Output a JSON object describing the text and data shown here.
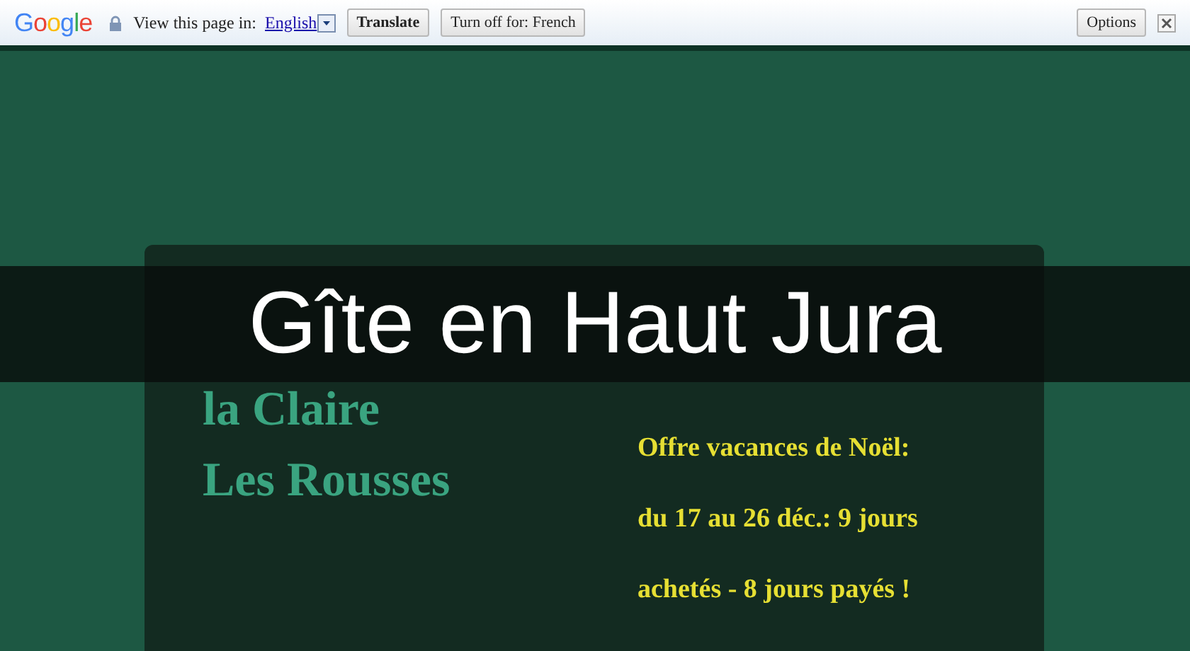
{
  "translate_bar": {
    "logo": "Google",
    "prompt": "View this page in:",
    "language": "English",
    "translate_button": "Translate",
    "turn_off_button": "Turn off for: French",
    "options_button": "Options"
  },
  "banner": {
    "title": "Gîte en Haut Jura"
  },
  "page": {
    "heading_lines": [
      "la Claire",
      "Les Rousses"
    ],
    "offer_lines": [
      "Offre vacances de Noël:",
      "du 17 au 26 déc.: 9 jours",
      "achetés - 8 jours payés !"
    ]
  }
}
